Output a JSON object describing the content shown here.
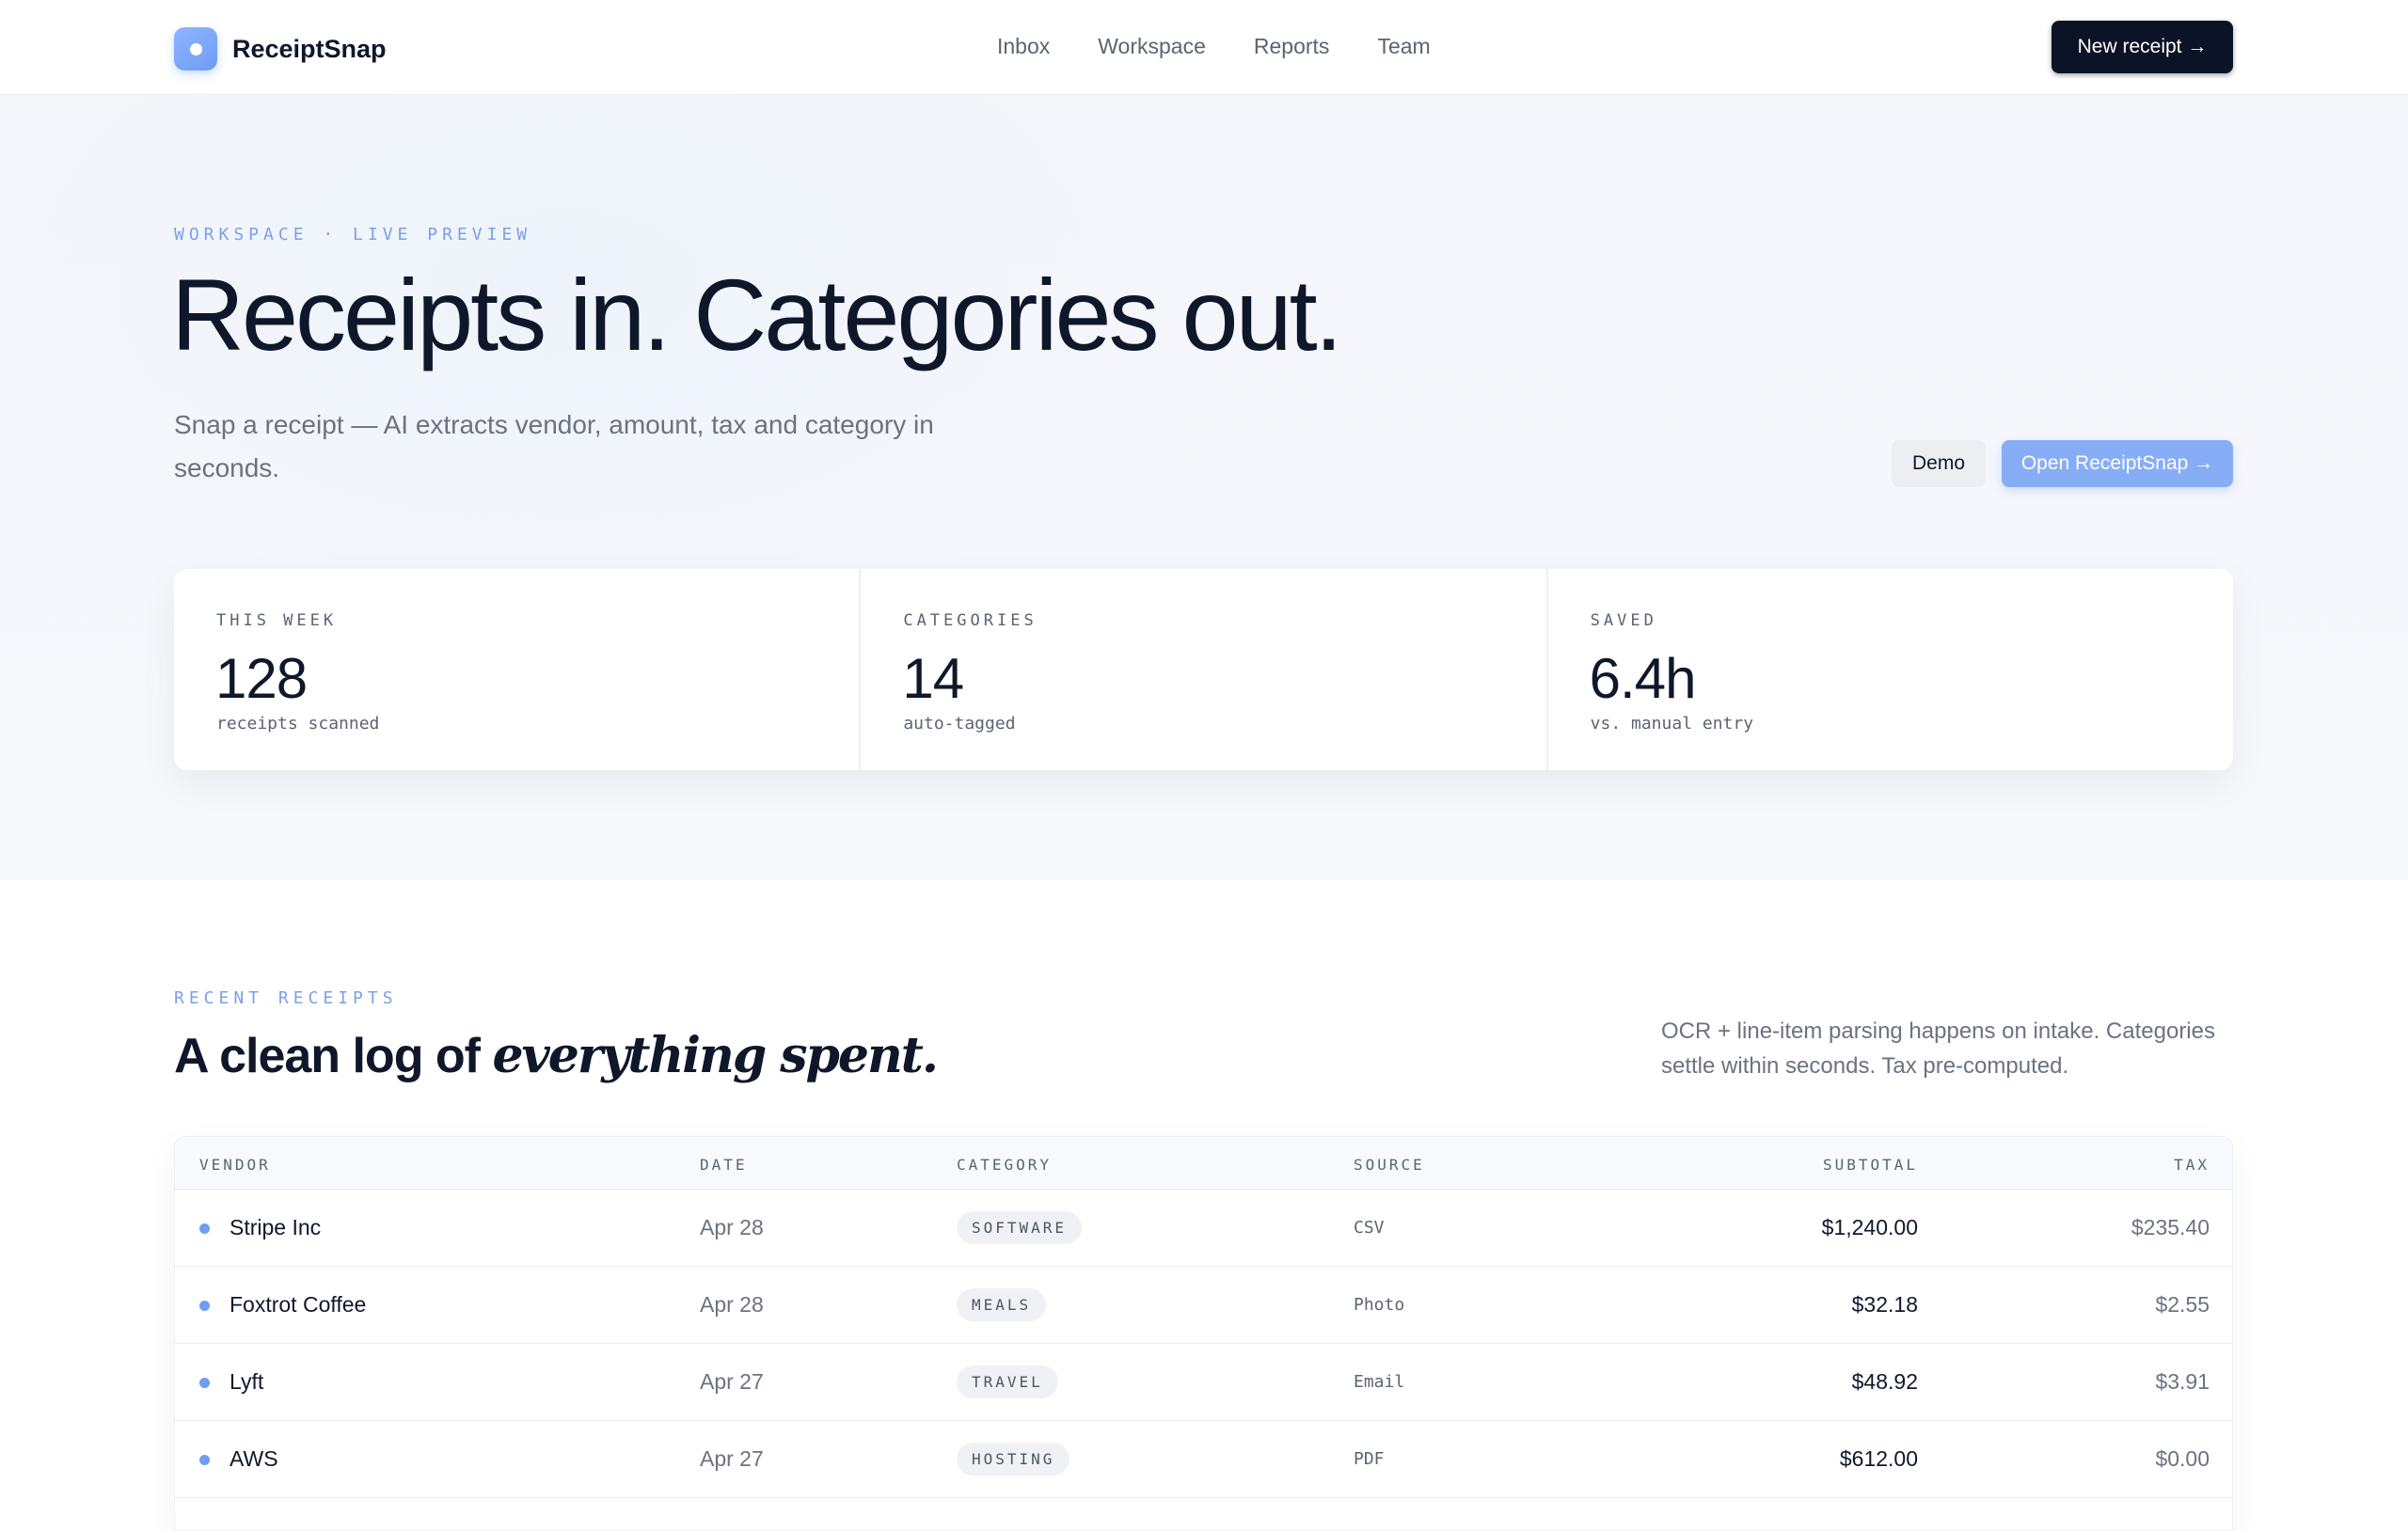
{
  "app": {
    "name": "ReceiptSnap"
  },
  "nav": {
    "links": [
      "Inbox",
      "Workspace",
      "Reports",
      "Team"
    ],
    "new_receipt": "New receipt →"
  },
  "hero": {
    "eyebrow": "WORKSPACE · LIVE PREVIEW",
    "title": "Receipts in. Categories out.",
    "subtitle": "Snap a receipt — AI extracts vendor, amount, tax and category in seconds.",
    "demo_button": "Demo",
    "open_button": "Open ReceiptSnap →"
  },
  "stats": [
    {
      "label": "THIS WEEK",
      "value": "128",
      "note": "receipts scanned"
    },
    {
      "label": "CATEGORIES",
      "value": "14",
      "note": "auto-tagged"
    },
    {
      "label": "SAVED",
      "value": "6.4h",
      "note": "vs. manual entry"
    }
  ],
  "recent": {
    "eyebrow": "RECENT RECEIPTS",
    "title_plain": "A clean log of ",
    "title_italic": "everything spent.",
    "note": "OCR + line-item parsing happens on intake. Categories settle within seconds. Tax pre-computed."
  },
  "table": {
    "headers": [
      "VENDOR",
      "DATE",
      "CATEGORY",
      "SOURCE",
      "SUBTOTAL",
      "TAX"
    ],
    "rows": [
      {
        "vendor": "Stripe Inc",
        "date": "Apr 28",
        "category": "SOFTWARE",
        "source": "CSV",
        "subtotal": "$1,240.00",
        "tax": "$235.40"
      },
      {
        "vendor": "Foxtrot Coffee",
        "date": "Apr 28",
        "category": "MEALS",
        "source": "Photo",
        "subtotal": "$32.18",
        "tax": "$2.55"
      },
      {
        "vendor": "Lyft",
        "date": "Apr 27",
        "category": "TRAVEL",
        "source": "Email",
        "subtotal": "$48.92",
        "tax": "$3.91"
      },
      {
        "vendor": "AWS",
        "date": "Apr 27",
        "category": "HOSTING",
        "source": "PDF",
        "subtotal": "$612.00",
        "tax": "$0.00"
      }
    ]
  },
  "colors": {
    "accent": "#6f9cf5",
    "dark": "#0b1426"
  }
}
